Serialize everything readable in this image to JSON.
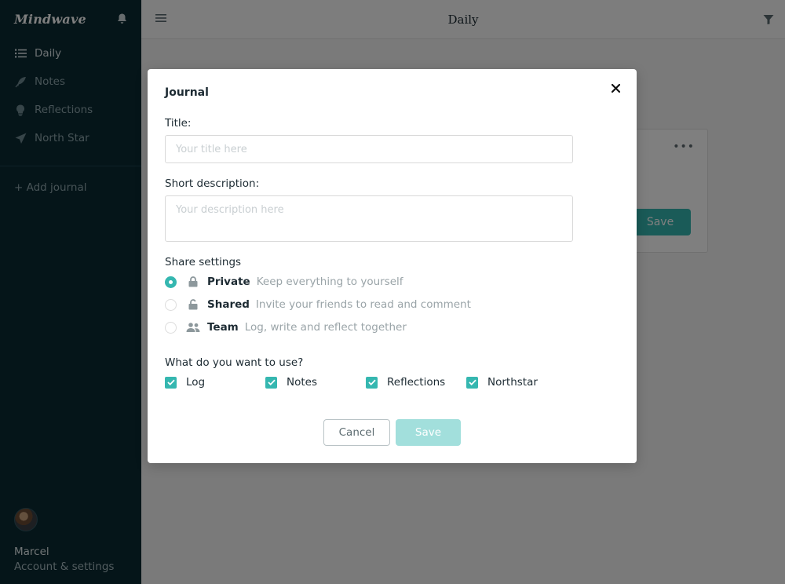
{
  "app": {
    "name": "Mindwave"
  },
  "sidebar": {
    "items": [
      {
        "label": "Daily",
        "icon": "list-icon"
      },
      {
        "label": "Notes",
        "icon": "feather-icon"
      },
      {
        "label": "Reflections",
        "icon": "lightbulb-icon"
      },
      {
        "label": "North Star",
        "icon": "paper-plane-icon"
      }
    ],
    "add_journal": "+ Add journal",
    "user": {
      "name": "Marcel",
      "settings_label": "Account & settings"
    }
  },
  "header": {
    "title": "Daily"
  },
  "card": {
    "more_label": "•••",
    "save_label": "Save"
  },
  "modal": {
    "title": "Journal",
    "close_label": "×",
    "title_field": {
      "label": "Title:",
      "placeholder": "Your title here",
      "value": ""
    },
    "description_field": {
      "label": "Short description:",
      "placeholder": "Your description here",
      "value": ""
    },
    "share": {
      "heading": "Share settings",
      "options": [
        {
          "name": "Private",
          "description": "Keep everything to yourself",
          "icon": "lock-icon",
          "selected": true
        },
        {
          "name": "Shared",
          "description": "Invite your friends to read and comment",
          "icon": "lock-open-icon",
          "selected": false
        },
        {
          "name": "Team",
          "description": "Log, write and reflect together",
          "icon": "users-icon",
          "selected": false
        }
      ]
    },
    "features": {
      "heading": "What do you want to use?",
      "options": [
        {
          "label": "Log",
          "checked": true
        },
        {
          "label": "Notes",
          "checked": true
        },
        {
          "label": "Reflections",
          "checked": true
        },
        {
          "label": "Northstar",
          "checked": true
        }
      ]
    },
    "cancel_label": "Cancel",
    "save_label": "Save"
  },
  "colors": {
    "sidebar_bg": "#0b2a33",
    "accent": "#35b7b0",
    "accent_disabled": "#a2dfdc"
  }
}
